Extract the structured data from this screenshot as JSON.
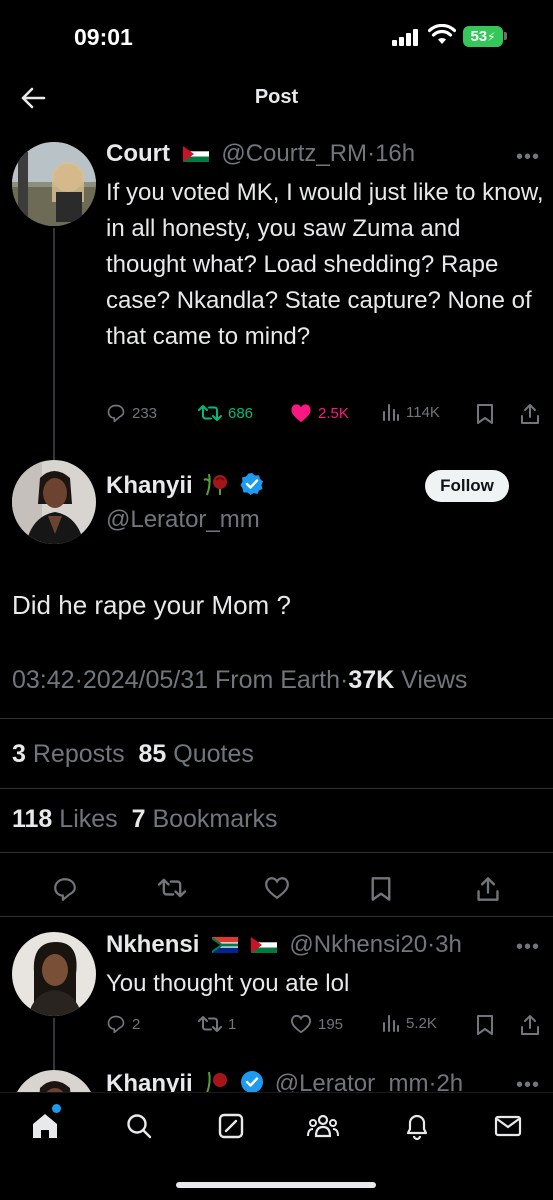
{
  "status_bar": {
    "time": "09:01",
    "battery": "53"
  },
  "header": {
    "title": "Post"
  },
  "tweet1": {
    "name": "Court",
    "handle": "@Courtz_RM",
    "sep": "·",
    "time": "16h",
    "text": "If you voted MK, I would just like to know, in all honesty, you saw Zuma and thought what? Load shedding? Rape case? Nkandla? State capture? None of that came to mind?",
    "replies": "233",
    "reposts": "686",
    "likes": "2.5K",
    "views": "114K"
  },
  "main_tweet": {
    "name": "Khanyii",
    "handle": "@Lerator_mm",
    "follow_label": "Follow",
    "text": "Did he rape your Mom ?",
    "time": "03:42",
    "sep": "·",
    "date": "2024/05/31",
    "source": "From Earth",
    "views_count": "37K",
    "views_label": "Views",
    "reposts_count": "3",
    "reposts_label": "Reposts",
    "quotes_count": "85",
    "quotes_label": "Quotes",
    "likes_count": "118",
    "likes_label": "Likes",
    "bookmarks_count": "7",
    "bookmarks_label": "Bookmarks"
  },
  "reply1": {
    "name": "Nkhensi",
    "handle": "@Nkhensi20",
    "sep": "·",
    "time": "3h",
    "text": "You thought you ate lol",
    "replies": "2",
    "reposts": "1",
    "likes": "195",
    "views": "5.2K"
  },
  "reply2": {
    "name": "Khanyii",
    "handle": "@Lerator_mm",
    "sep": "·",
    "time": "2h"
  },
  "colors": {
    "accent": "#1d9bf0",
    "like": "#f91880",
    "repost": "#00ba7c",
    "muted": "#71767b"
  },
  "icons": [
    "back-arrow-icon",
    "reply-icon",
    "repost-icon",
    "heart-icon",
    "views-icon",
    "bookmark-icon",
    "share-icon",
    "verified-icon",
    "home-icon",
    "search-icon",
    "grok-icon",
    "communities-icon",
    "bell-icon",
    "mail-icon"
  ]
}
